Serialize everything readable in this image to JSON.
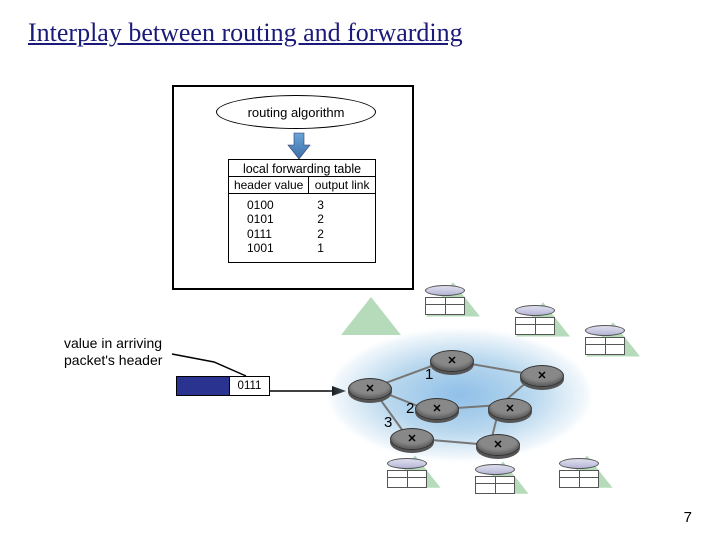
{
  "title": "Interplay between routing and forwarding",
  "algorithm_label": "routing algorithm",
  "forwarding_table": {
    "title": "local forwarding table",
    "col1": "header value",
    "col2": "output link",
    "rows": [
      {
        "hv": "0100",
        "ol": "3"
      },
      {
        "hv": "0101",
        "ol": "2"
      },
      {
        "hv": "0111",
        "ol": "2"
      },
      {
        "hv": "1001",
        "ol": "1"
      }
    ]
  },
  "arriving_label_l1": "value in arriving",
  "arriving_label_l2": "packet's header",
  "packet_header_value": "0111",
  "link_labels": {
    "one": "1",
    "two": "2",
    "three": "3"
  },
  "page_number": "7"
}
